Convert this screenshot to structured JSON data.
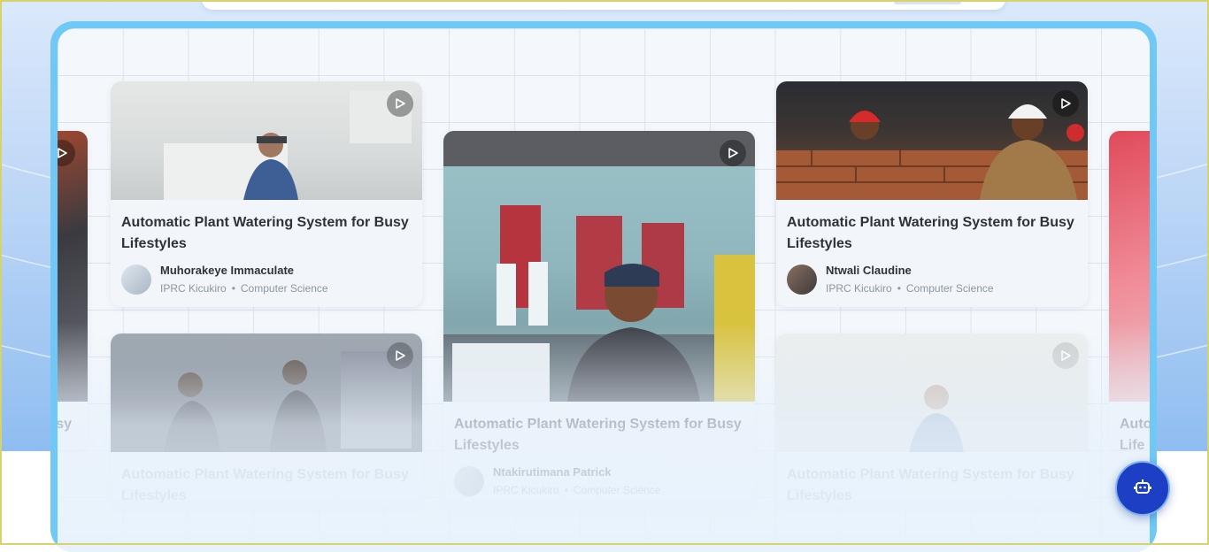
{
  "projects": [
    {
      "title": "Automatic Plant Watering System for Busy Lifestyles",
      "author": "Muhorakeye Immaculate",
      "school": "IPRC Kicukiro",
      "department": "Computer Science"
    },
    {
      "title": "Automatic Plant Watering System for Busy Lifestyles",
      "author": "Ntakirutimana Patrick",
      "school": "IPRC Kicukiro",
      "department": "Computer Science"
    },
    {
      "title": "Automatic Plant Watering System for Busy Lifestyles",
      "author": "Ntwali Claudine",
      "school": "IPRC Kicukiro",
      "department": "Computer Science"
    },
    {
      "title": "Automatic Plant Watering System for Busy Lifestyles"
    },
    {
      "title": "Automatic Plant Watering System for Busy Lifestyles"
    }
  ],
  "edge_left_title_fragment": "sy",
  "edge_right_title_fragment": "Auto\nLife",
  "meta_separator": "•",
  "icons": {
    "play": "play-icon",
    "chatbot": "robot-icon"
  },
  "colors": {
    "showcase_border": "#6fc8f5",
    "chat_button": "#1d3fc4"
  }
}
